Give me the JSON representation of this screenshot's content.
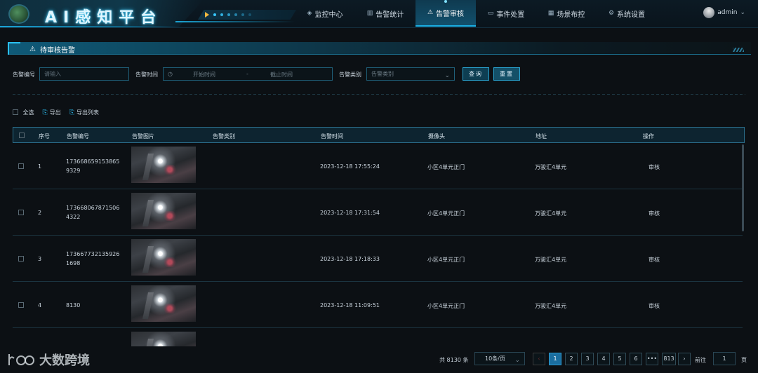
{
  "app": {
    "title": "AI感知平台"
  },
  "nav": {
    "items": [
      {
        "icon": "◈",
        "label": "监控中心"
      },
      {
        "icon": "▥",
        "label": "告警统计"
      },
      {
        "icon": "⚠",
        "label": "告警审核"
      },
      {
        "icon": "▭",
        "label": "事件处置"
      },
      {
        "icon": "▦",
        "label": "场景布控"
      },
      {
        "icon": "⚙",
        "label": "系统设置"
      }
    ],
    "active_index": 2
  },
  "user": {
    "name": "admin",
    "chevron": "⌄"
  },
  "section": {
    "title": "待审核告警",
    "icon": "⚠"
  },
  "filters": {
    "alarm_no_label": "告警编号",
    "alarm_no_placeholder": "请输入",
    "time_label": "告警时间",
    "time_start_placeholder": "开始时间",
    "time_sep": "-",
    "time_end_placeholder": "截止时间",
    "type_label": "告警类别",
    "type_placeholder": "告警类别",
    "query_btn": "查询",
    "reset_btn": "重置"
  },
  "tools": {
    "select_all": "全选",
    "export": "导出",
    "export_list": "导出列表"
  },
  "table": {
    "headers": {
      "index": "序号",
      "alarm_no": "告警编号",
      "image": "告警图片",
      "type": "告警类别",
      "time": "告警时间",
      "camera": "摄像头",
      "address": "地址",
      "action": "操作"
    },
    "rows": [
      {
        "index": "1",
        "alarm_no": "1736686591538659329",
        "type": "",
        "time": "2023-12-18 17:55:24",
        "camera": "小区4单元正门",
        "address": "万骏汇4单元",
        "action": "审核"
      },
      {
        "index": "2",
        "alarm_no": "1736680678715064322",
        "type": "",
        "time": "2023-12-18 17:31:54",
        "camera": "小区4单元正门",
        "address": "万骏汇4单元",
        "action": "审核"
      },
      {
        "index": "3",
        "alarm_no": "1736677321359261698",
        "type": "",
        "time": "2023-12-18 17:18:33",
        "camera": "小区4单元正门",
        "address": "万骏汇4单元",
        "action": "审核"
      },
      {
        "index": "4",
        "alarm_no": "8130",
        "type": "",
        "time": "2023-12-18 11:09:51",
        "camera": "小区4单元正门",
        "address": "万骏汇4单元",
        "action": "审核"
      },
      {
        "index": "",
        "alarm_no": "",
        "type": "",
        "time": "",
        "camera": "",
        "address": "",
        "action": ""
      }
    ]
  },
  "pagination": {
    "total": "共 8130 条",
    "page_size": "10条/页",
    "prev": "‹",
    "pages": [
      "1",
      "2",
      "3",
      "4",
      "5",
      "6",
      "•••",
      "813"
    ],
    "next": "›",
    "goto_label": "前往",
    "goto_value": "1",
    "page_unit": "页"
  },
  "watermark": {
    "text": "大数跨境"
  }
}
